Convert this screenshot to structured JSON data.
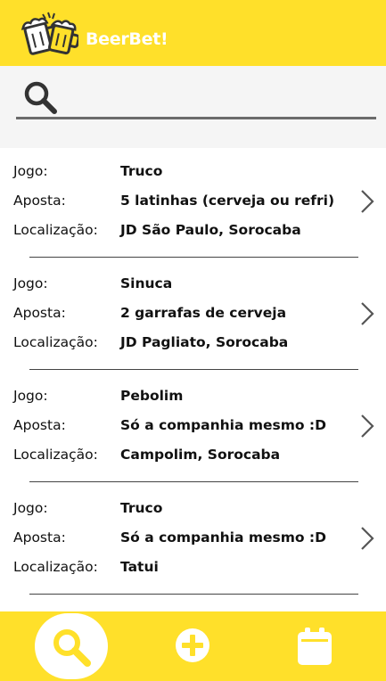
{
  "app": {
    "title": "BeerBet!",
    "brand_color": "#ffe02a"
  },
  "search": {
    "value": "",
    "placeholder": "",
    "icon": "search-icon"
  },
  "bets": [
    {
      "game_label": "Jogo:",
      "game": "Truco",
      "bet_label": "Aposta:",
      "bet": "5 latinhas (cerveja ou refri)",
      "location_label": "Localização:",
      "location": "JD São Paulo, Sorocaba"
    },
    {
      "game_label": "Jogo:",
      "game": "Sinuca",
      "bet_label": "Aposta:",
      "bet": "2 garrafas de cerveja",
      "location_label": "Localização:",
      "location": "JD Pagliato, Sorocaba"
    },
    {
      "game_label": "Jogo:",
      "game": "Pebolim",
      "bet_label": "Aposta:",
      "bet": "Só a companhia mesmo :D",
      "location_label": "Localização:",
      "location": "Campolim, Sorocaba"
    },
    {
      "game_label": "Jogo:",
      "game": "Truco",
      "bet_label": "Aposta:",
      "bet": "Só a companhia mesmo :D",
      "location_label": "Localização:",
      "location": "Tatui"
    }
  ],
  "bottom_nav": {
    "items": [
      {
        "icon": "search-icon",
        "active": true
      },
      {
        "icon": "add-circle-icon",
        "active": false
      },
      {
        "icon": "calendar-icon",
        "active": false
      }
    ]
  }
}
